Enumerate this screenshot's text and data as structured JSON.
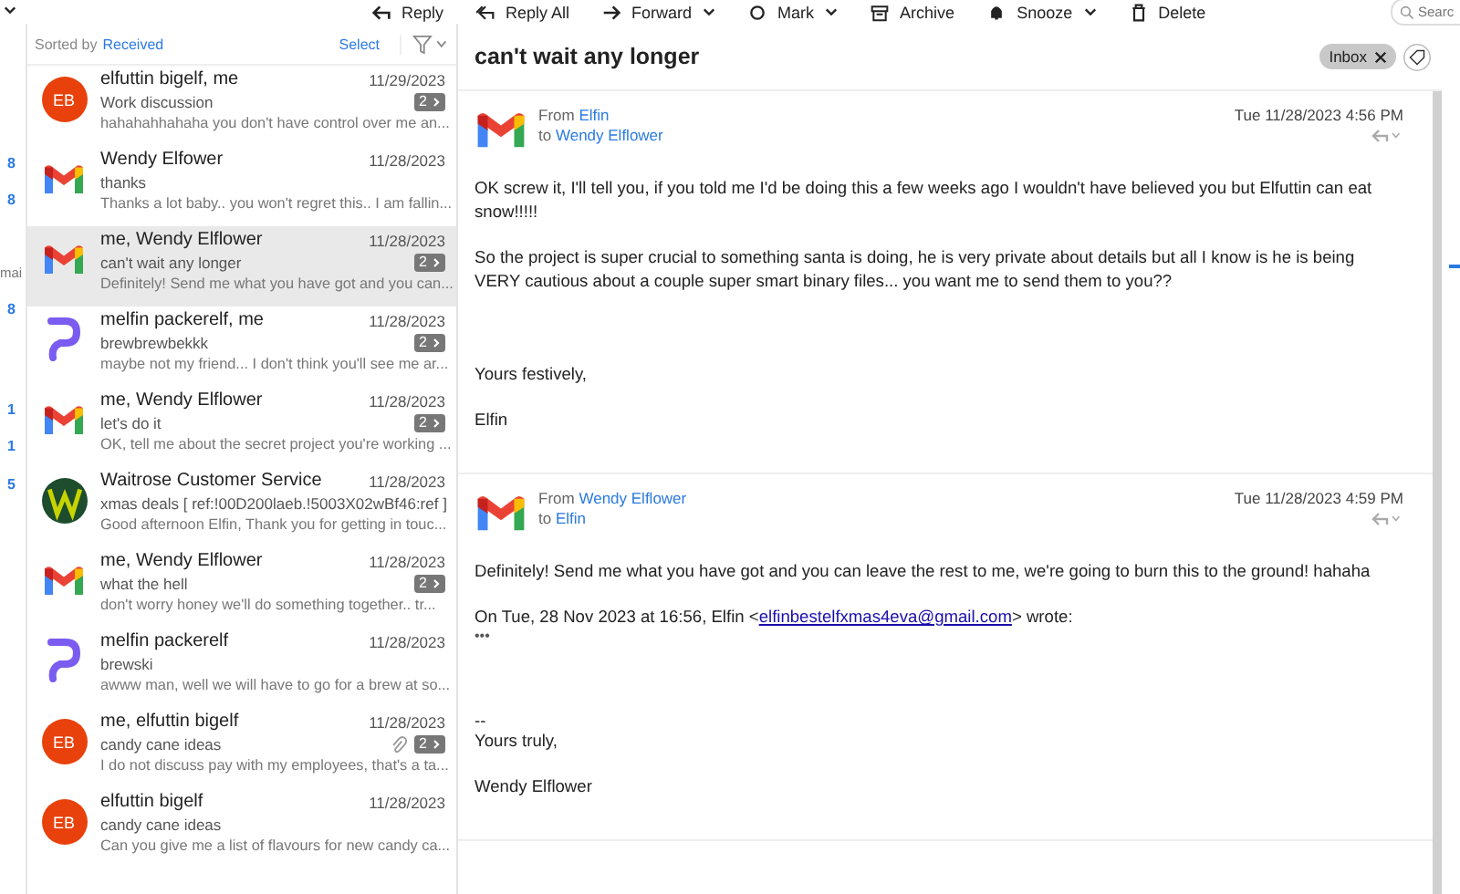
{
  "toolbar": {
    "actions": [
      {
        "label": "Reply",
        "menu": false
      },
      {
        "label": "Reply All",
        "menu": false
      },
      {
        "label": "Forward",
        "menu": true
      },
      {
        "label": "Mark",
        "menu": true
      },
      {
        "label": "Archive",
        "menu": false
      },
      {
        "label": "Snooze",
        "menu": true
      },
      {
        "label": "Delete",
        "menu": false
      }
    ],
    "search": {
      "placeholder": "Searc"
    }
  },
  "folder_pane_edge": [
    {
      "text": "8"
    },
    {
      "text": "8"
    },
    {
      "text": "mai"
    },
    {
      "text": "8"
    },
    {
      "text": "1"
    },
    {
      "text": "1"
    },
    {
      "text": "5"
    }
  ],
  "message_list": {
    "sort_label": "Sorted by",
    "sort_field": "Received",
    "select": "Select",
    "items": [
      {
        "kind": "initials",
        "initials": "EB",
        "sender": "elfuttin bigelf, me",
        "date": "11/29/2023",
        "subject": "Work discussion",
        "preview": "hahahahhahaha you don't have control over me an...",
        "thread_count": "2",
        "attachment": false,
        "selected": false
      },
      {
        "kind": "gmail",
        "sender": "Wendy Elfower",
        "date": "11/28/2023",
        "subject": "thanks",
        "preview": "Thanks a lot baby.. you won't regret this.. I am fallin...",
        "attachment": false,
        "selected": false
      },
      {
        "kind": "gmail",
        "sender": "me, Wendy Elflower",
        "date": "11/28/2023",
        "subject": "can't wait any longer",
        "preview": "Definitely! Send me what you have got and you can...",
        "thread_count": "2",
        "attachment": false,
        "selected": true
      },
      {
        "kind": "proton",
        "sender": "melfin packerelf, me",
        "date": "11/28/2023",
        "subject": "brewbrewbekkk",
        "preview": "maybe not my friend... I don't think you'll see me ar...",
        "thread_count": "2",
        "attachment": false,
        "selected": false
      },
      {
        "kind": "gmail",
        "sender": "me, Wendy Elflower",
        "date": "11/28/2023",
        "subject": "let's do it",
        "preview": "OK, tell me about the secret project you're working ...",
        "thread_count": "2",
        "attachment": false,
        "selected": false
      },
      {
        "kind": "waitrose",
        "sender": "Waitrose Customer Service",
        "date": "11/28/2023",
        "subject": "xmas deals [ ref:!00D200laeb.!5003X02wBf46:ref ]",
        "preview": "Good afternoon Elfin, Thank you for getting in touc...",
        "attachment": false,
        "selected": false
      },
      {
        "kind": "gmail",
        "sender": "me, Wendy Elflower",
        "date": "11/28/2023",
        "subject": "what the hell",
        "preview": "don't worry honey we'll do something together.. tr...",
        "thread_count": "2",
        "attachment": false,
        "selected": false
      },
      {
        "kind": "proton",
        "sender": "melfin packerelf",
        "date": "11/28/2023",
        "subject": "brewski",
        "preview": "awww man, well we will have to go for a brew at so...",
        "attachment": false,
        "selected": false
      },
      {
        "kind": "initials",
        "initials": "EB",
        "sender": "me, elfuttin bigelf",
        "date": "11/28/2023",
        "subject": "candy cane ideas",
        "preview": "I do not discuss pay with my employees, that's a ta...",
        "thread_count": "2",
        "attachment": true,
        "selected": false
      },
      {
        "kind": "initials",
        "initials": "EB",
        "sender": "elfuttin bigelf",
        "date": "11/28/2023",
        "subject": "candy cane ideas",
        "preview": "Can you give me a list of flavours for new candy ca...",
        "attachment": false,
        "selected": false
      }
    ]
  },
  "reading_pane": {
    "subject": "can't wait any longer",
    "tag": "Inbox",
    "messages": [
      {
        "from_label": "From",
        "from": "Elfin",
        "to_label": "to",
        "to": "Wendy Elflower",
        "date": "Tue 11/28/2023 4:56 PM",
        "body": [
          {
            "kind": "text",
            "text": "OK screw it, I'll tell you, if you told me I'd be doing this a few weeks ago I wouldn't have believed you but Elfuttin can eat snow!!!!!"
          },
          {
            "kind": "text",
            "text": "So the project is super crucial to something santa is doing, he is very private about details but all I know is he is being VERY cautious about a couple super smart binary files... you want me to send them to you??"
          },
          {
            "kind": "gap"
          },
          {
            "kind": "text",
            "text": "Yours festively,"
          },
          {
            "kind": "text",
            "text": "Elfin"
          }
        ]
      },
      {
        "from_label": "From",
        "from": "Wendy Elflower",
        "to_label": "to",
        "to": "Elfin",
        "date": "Tue 11/28/2023 4:59 PM",
        "body": [
          {
            "kind": "text",
            "text": "Definitely! Send me what you have got and you can leave the rest to me, we're going to burn this to the ground! hahaha"
          },
          {
            "kind": "quote",
            "before": "On Tue, 28 Nov 2023 at 16:56, Elfin <",
            "link": "elfinbestelfxmas4eva@gmail.com",
            "after": "> wrote:",
            "more": "•••"
          },
          {
            "kind": "gap"
          },
          {
            "kind": "sig",
            "dash": "--",
            "text": "Yours truly,"
          },
          {
            "kind": "text",
            "text": "Wendy Elflower"
          }
        ]
      }
    ]
  }
}
